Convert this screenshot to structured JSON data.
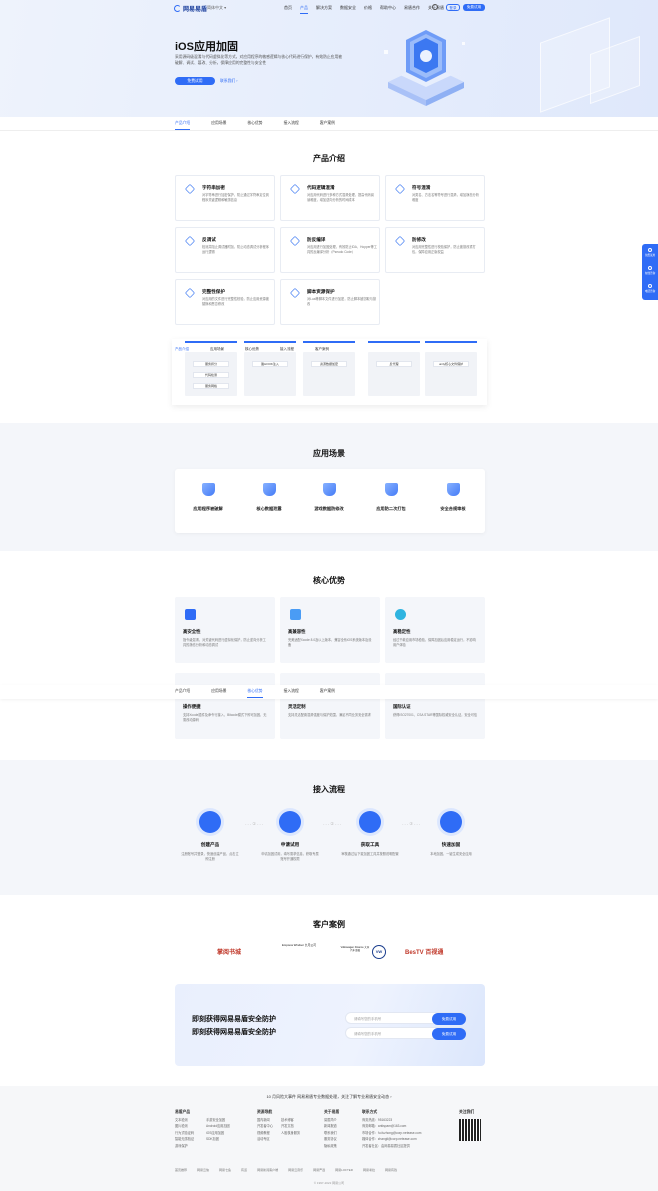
{
  "header": {
    "logo": "网易易盾",
    "lang": "简体中文",
    "nav": [
      "首页",
      "产品",
      "解决方案",
      "数据安全",
      "价格",
      "帮助中心",
      "易盾合作",
      "关于易盾"
    ],
    "nav_active": "产品",
    "login": "登录",
    "trial": "免费试用"
  },
  "hero": {
    "title": "iOS应用加固",
    "desc": "采用源码级混淆与代码虚拟化等方式，对应用程序的敏感逻辑与核心代码进行保护，有效防止应用被破解、调试、篡改、分析，保障应用的完整性与安全性",
    "btn_primary": "免费试用",
    "btn_secondary": "联系我们 ›"
  },
  "tabs": [
    "产品介绍",
    "应用场景",
    "核心优势",
    "接入流程",
    "客户案例"
  ],
  "tab_active": "产品介绍",
  "intro": {
    "title": "产品介绍",
    "cards": [
      {
        "title": "字符串加密",
        "desc": "对字符串进行加密保护，防止通过字符串定位到程序关键逻辑和敏感信息"
      },
      {
        "title": "代码逻辑混淆",
        "desc": "对应用代码进行多种方式混淆处理，提高代码阅读难度，增加逆向分析的时间成本"
      },
      {
        "title": "符号混淆",
        "desc": "对类名、方法名等符号进行混淆，增加静态分析难度"
      },
      {
        "title": "反调试",
        "desc": "检测并阻止调试器附加，防止动态调试分析程序运行逻辑"
      },
      {
        "title": "防反编译",
        "desc": "对应用进行加固处理，有效防止IDA、Hopper等工具的反编译分析（Pseudo Code）"
      },
      {
        "title": "防修改",
        "desc": "对应用完整性进行校验保护，防止被篡改重打包，保障应用正版权益"
      },
      {
        "title": "完整性保护",
        "desc": "对应用的文件进行完整性校验，防止应用资源被替换和恶意修改"
      },
      {
        "title": "脚本资源保护",
        "desc": "对Lua等脚本文件进行加密，防止脚本被窃取与篡改"
      }
    ]
  },
  "overlay": {
    "tabs": [
      "产品介绍",
      "应用场景",
      "核心优势",
      "接入流程",
      "客户案例"
    ],
    "col1": [
      "服务拆分",
      "代码检测",
      "服务网格"
    ],
    "col2": [
      "脱HOOK注入"
    ],
    "col3": [
      "资源数据加密"
    ],
    "col4": [
      "反代理"
    ],
    "col5": [
      "unity核心文件保护"
    ]
  },
  "scenes": {
    "title": "应用场景",
    "items": [
      "应用程序被破解",
      "核心数据泄露",
      "游戏数据防修改",
      "应用防二次打包",
      "安全合规审核"
    ]
  },
  "advantages": {
    "title": "核心优势",
    "cards": [
      {
        "title": "高安全性",
        "desc": "指令级混淆，对关键代码进行虚拟化保护，防止逆向分析工具的静态分析和动态调试"
      },
      {
        "title": "高兼容性",
        "desc": "完美适配Xcode 8.0及以上版本，兼容全系iOS系统版本及设备"
      },
      {
        "title": "高稳定性",
        "desc": "经过千款应用市场检验，保障加固后应用稳定运行，不影响用户体验"
      },
      {
        "title": "操作便捷",
        "desc": "支持Xcode插件及命令行接入，Bitcode模式下即可加固，无需改动源码"
      },
      {
        "title": "灵活定制",
        "desc": "支持灵活配置混淆强度与保护范围，满足不同业务安全需求"
      },
      {
        "title": "国际认证",
        "desc": "获得ISO27001、CSA STAR等国际权威安全认证，安全可信"
      }
    ],
    "sticky_tabs": [
      "产品介绍",
      "应用场景",
      "核心优势",
      "接入流程",
      "客户案例"
    ],
    "sticky_active": "核心优势"
  },
  "process": {
    "title": "接入流程",
    "steps": [
      {
        "title": "创建产品",
        "desc": "注册账号并登录，快速创建产品，点击立即注册"
      },
      {
        "title": "申请试用",
        "desc": "申请加固试用，填写需求信息，获取专属账号开通权限"
      },
      {
        "title": "获取工具",
        "desc": "审核通过后下载加固工具并按照说明配置"
      },
      {
        "title": "快速加固",
        "desc": "本地加固，一键生成安全应用"
      }
    ]
  },
  "cases": {
    "title": "客户案例",
    "logos": [
      "掌阅书城",
      "Empress Windsor 九号公司",
      "Volkswagen Finance 大众汽车金融",
      "VW",
      "BesTV 百视通"
    ]
  },
  "cta": {
    "line1": "即刻获得网易易盾安全防护",
    "line2": "即刻获得网易易盾安全防护",
    "input1": "请填写您的手机号",
    "input2": "请填写您的手机号",
    "btn": "免费试用"
  },
  "footer": {
    "top": "10 月风险大事件 网易易盾专业数据处理，关注了解专业易盾安全动态 ›",
    "cols": [
      {
        "head": "易盾产品",
        "items": [
          "文本检测",
          "图片检测",
          "行为式验证码",
          "智能无感验证",
          "游戏保护"
        ]
      },
      {
        "head": "",
        "items": [
          "手游安全加固",
          "Android应用加固",
          "iOS应用加固",
          "SDK加固",
          ""
        ]
      },
      {
        "head": "资源导航",
        "items": [
          "国内新闻",
          "开发者中心",
          "视频教程",
          "活动专区"
        ]
      },
      {
        "head": "",
        "items": [
          "技术博客",
          "开发文档",
          "人脸核身服务"
        ]
      },
      {
        "head": "关于易盾",
        "items": [
          "易盾简介",
          "新闻报道",
          "联系我们",
          "服务协议",
          "隐私政策"
        ]
      },
      {
        "head": "联系方式",
        "items": [
          "商务热线：95163223",
          "商务邮箱：antispam@163.com",
          "市场合作：fu.fuzhong@corp.netease.com",
          "媒体合作：zhangli@corp.netease.com",
          "开发者社区：由网易易盾社区提供"
        ]
      }
    ],
    "follow": "关注我们",
    "links": [
      "首页推荐",
      "网易云信",
      "网易七鱼",
      "有道",
      "网易新闻客户端",
      "网易云音乐",
      "网易严选",
      "网易LOFTER",
      "网易考拉",
      "网易有钱"
    ],
    "copyright": "© 1997-2022 网易公司"
  },
  "floating": [
    "免费试用",
    "在线咨询",
    "电话咨询"
  ],
  "colors": {
    "accent": "#2f6cf6",
    "hero_bg": "#e7eefc",
    "section_bg": "#f4f6fa"
  }
}
